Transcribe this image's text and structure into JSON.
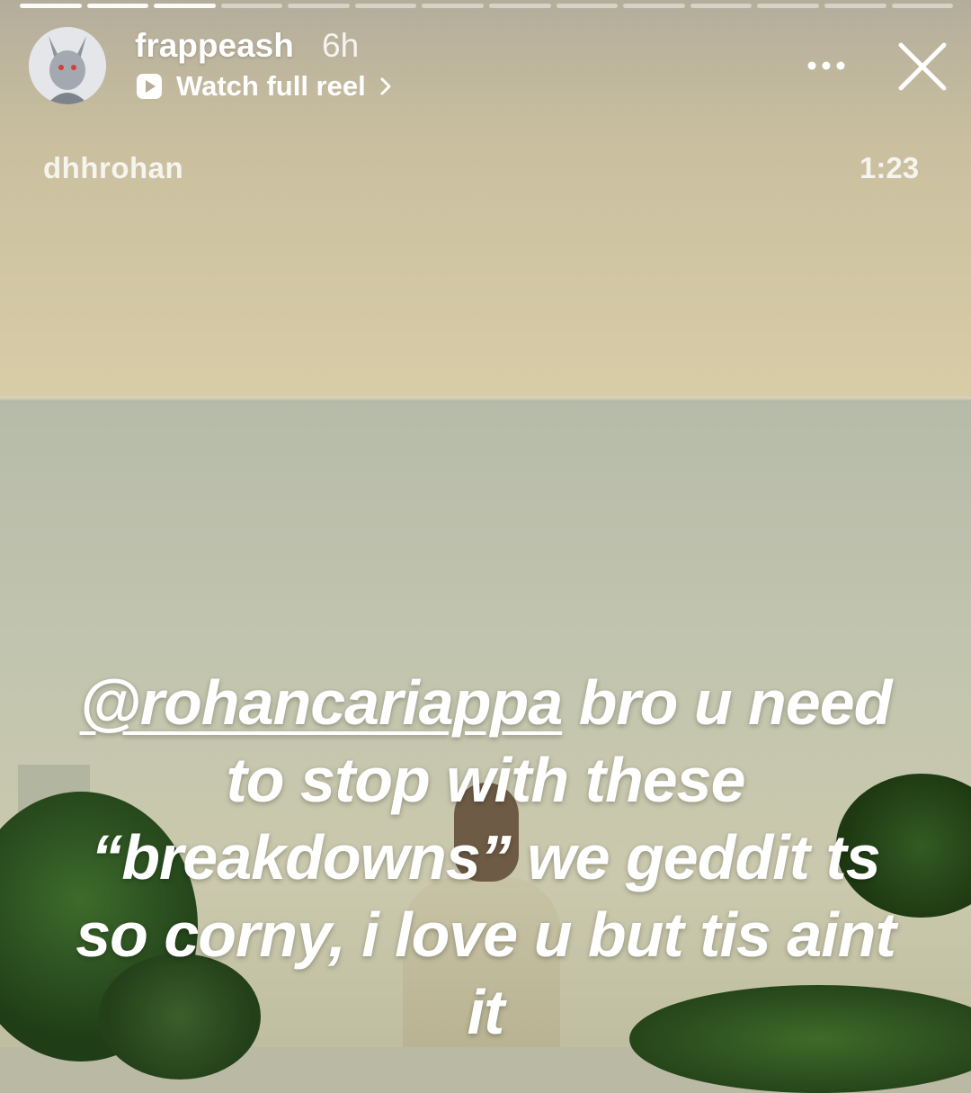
{
  "story": {
    "progress": {
      "total_segments": 14,
      "current_segment": 3
    },
    "header": {
      "username": "frappeash",
      "age": "6h",
      "watch_label": "Watch full reel"
    },
    "reel": {
      "author": "dhhrohan",
      "duration": "1:23"
    },
    "caption": {
      "mention": "@rohancariappa",
      "text": " bro u need to stop with these “breakdowns” we geddit ts so corny, i love u but tis aint it"
    }
  },
  "icons": {
    "play": "play-icon",
    "chevron": "chevron-right-icon",
    "more": "more-options-icon",
    "close": "close-icon"
  },
  "colors": {
    "text": "#ffffff",
    "progress_active": "#ffffff"
  }
}
